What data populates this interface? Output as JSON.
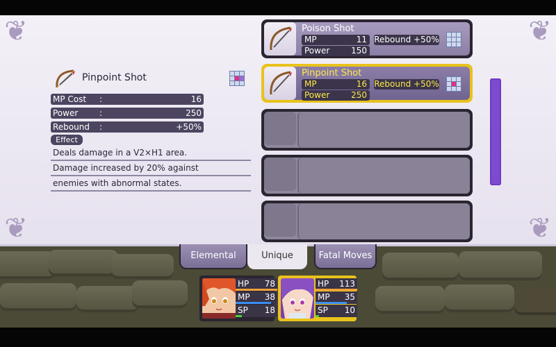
{
  "detail": {
    "name": "Pinpoint Shot",
    "stats": [
      {
        "label": "MP Cost",
        "colon": ":",
        "value": "16"
      },
      {
        "label": "Power",
        "colon": ":",
        "value": "250"
      },
      {
        "label": "Rebound",
        "colon": ":",
        "value": "+50%"
      }
    ],
    "effect_label": "Effect",
    "description": [
      "Deals damage in a V2×H1 area.",
      "Damage increased by 20% against",
      "enemies with abnormal states."
    ]
  },
  "skills": [
    {
      "name": "Poison Shot",
      "mp_label": "MP",
      "mp": "11",
      "power_label": "Power",
      "power": "150",
      "rebound": "Rebound +50%",
      "selected": false
    },
    {
      "name": "Pinpoint Shot",
      "mp_label": "MP",
      "mp": "16",
      "power_label": "Power",
      "power": "250",
      "rebound": "Rebound +50%",
      "selected": true
    }
  ],
  "empty_slots": 3,
  "tabs": [
    {
      "label": "Elemental",
      "active": false
    },
    {
      "label": "Unique",
      "active": true
    },
    {
      "label": "Fatal Moves",
      "active": false
    }
  ],
  "party": [
    {
      "hp_label": "HP",
      "hp": "78",
      "mp_label": "MP",
      "mp": "38",
      "sp_label": "SP",
      "sp": "18",
      "selected": false,
      "hp_fill": 1.0,
      "mp_fill": 0.85,
      "sp_fill": 0.15
    },
    {
      "hp_label": "HP",
      "hp": "113",
      "mp_label": "MP",
      "mp": "35",
      "sp_label": "SP",
      "sp": "10",
      "selected": true,
      "hp_fill": 1.0,
      "mp_fill": 0.75,
      "sp_fill": 0.08
    }
  ],
  "colors": {
    "accent_gold": "#e9c21c",
    "panel_purple": "#4d4560",
    "scroll_purple": "#7d4bd1"
  }
}
